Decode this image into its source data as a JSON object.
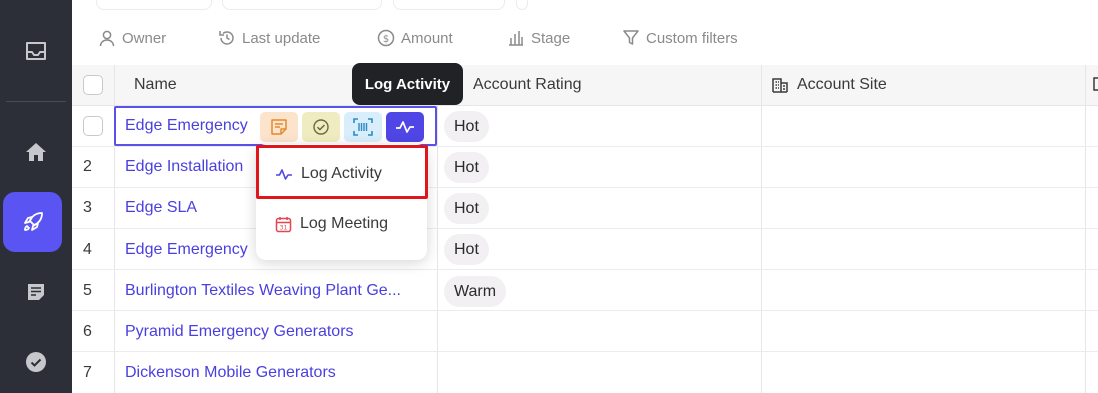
{
  "sidebar": {
    "icons": [
      "inbox-icon",
      "home-icon",
      "rocket-icon",
      "notes-icon",
      "check-circle-icon"
    ],
    "active": "rocket-icon",
    "accent": "#5a55f2",
    "background": "#2d2f38"
  },
  "filters": {
    "owner": "Owner",
    "last_update": "Last update",
    "amount": "Amount",
    "stage": "Stage",
    "custom_filters": "Custom filters"
  },
  "table": {
    "columns": {
      "name": "Name",
      "account_rating": "Account Rating",
      "account_site": "Account Site"
    },
    "rows": [
      {
        "num": "",
        "name": "Edge Emergency Generators",
        "rating": "Hot"
      },
      {
        "num": "2",
        "name": "Edge Installation",
        "rating": "Hot"
      },
      {
        "num": "3",
        "name": "Edge SLA",
        "rating": "Hot"
      },
      {
        "num": "4",
        "name": "Edge Emergency",
        "rating": "Hot"
      },
      {
        "num": "5",
        "name": "Burlington Textiles Weaving Plant Ge...",
        "rating": "Warm"
      },
      {
        "num": "6",
        "name": "Pyramid Emergency Generators",
        "rating": ""
      },
      {
        "num": "7",
        "name": "Dickenson Mobile Generators",
        "rating": ""
      }
    ],
    "selected_row_name": "Edge Emergency"
  },
  "quick_actions": {
    "icons": [
      "note-icon",
      "task-check-icon",
      "scan-icon",
      "activity-icon"
    ],
    "colors": [
      "#fbe3cc",
      "#f0ecc2",
      "#d8eefb",
      "#4f46e5"
    ]
  },
  "tooltip": {
    "text": "Log Activity"
  },
  "dropdown": {
    "log_activity": "Log Activity",
    "log_meeting": "Log Meeting",
    "highlight_color": "#e0161b"
  }
}
